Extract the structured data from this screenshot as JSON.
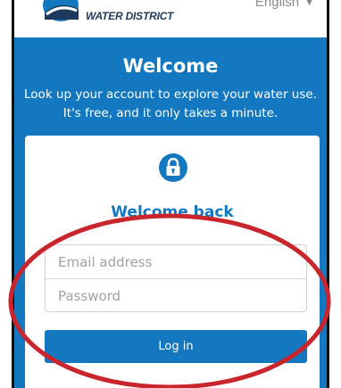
{
  "header": {
    "logo_text": "WATER DISTRICT",
    "language": "English",
    "language_icon": "chevron-down-icon"
  },
  "hero": {
    "title": "Welcome",
    "subtitle": "Look up your account to explore your water use. It's free, and it only takes a minute."
  },
  "login_card": {
    "icon": "lock-icon",
    "title": "Welcome back",
    "email_placeholder": "Email address",
    "password_placeholder": "Password",
    "login_label": "Log in"
  },
  "colors": {
    "brand_blue": "#1478c0",
    "annotation_red": "#c8262c"
  }
}
